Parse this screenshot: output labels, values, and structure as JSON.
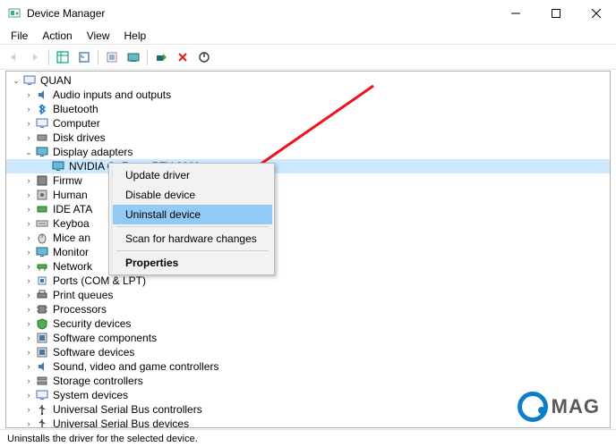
{
  "window": {
    "title": "Device Manager"
  },
  "menu": {
    "file": "File",
    "action": "Action",
    "view": "View",
    "help": "Help"
  },
  "tree": {
    "root": "QUAN",
    "nodes": [
      {
        "label": "Audio inputs and outputs"
      },
      {
        "label": "Bluetooth"
      },
      {
        "label": "Computer"
      },
      {
        "label": "Disk drives"
      },
      {
        "label": "Display adapters",
        "expanded": true,
        "children": [
          {
            "label": "NVIDIA GeForce RTX 3060",
            "selected": true
          }
        ]
      },
      {
        "label": "Firmw"
      },
      {
        "label": "Human"
      },
      {
        "label": "IDE ATA"
      },
      {
        "label": "Keyboa"
      },
      {
        "label": "Mice an"
      },
      {
        "label": "Monitor"
      },
      {
        "label": "Network"
      },
      {
        "label": "Ports (COM & LPT)"
      },
      {
        "label": "Print queues"
      },
      {
        "label": "Processors"
      },
      {
        "label": "Security devices"
      },
      {
        "label": "Software components"
      },
      {
        "label": "Software devices"
      },
      {
        "label": "Sound, video and game controllers"
      },
      {
        "label": "Storage controllers"
      },
      {
        "label": "System devices"
      },
      {
        "label": "Universal Serial Bus controllers"
      },
      {
        "label": "Universal Serial Bus devices"
      }
    ]
  },
  "context_menu": {
    "update": "Update driver",
    "disable": "Disable device",
    "uninstall": "Uninstall device",
    "scan": "Scan for hardware changes",
    "properties": "Properties"
  },
  "status": {
    "text": "Uninstalls the driver for the selected device."
  },
  "watermark": {
    "text": "MAG"
  }
}
